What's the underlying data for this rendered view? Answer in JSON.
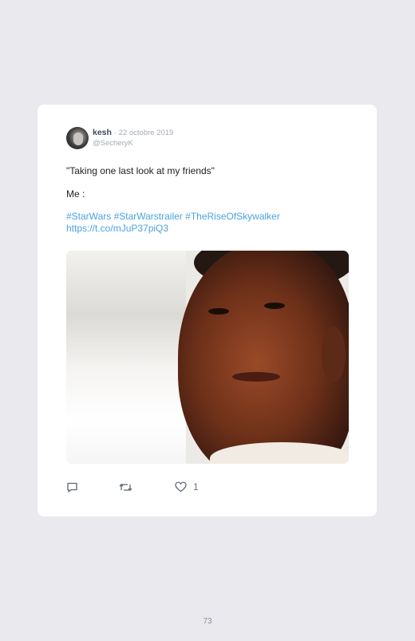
{
  "tweet": {
    "author_name": "kesh",
    "separator": "·",
    "date": "22 octobre 2019",
    "handle": "@SecheryK",
    "lines": [
      "\"Taking one last look at my friends\"",
      "Me :"
    ],
    "hashtags": "#StarWars #StarWarstrailer #TheRiseOfSkywalker",
    "url": "https://t.co/mJuP37piQ3",
    "like_count": "1"
  },
  "icons": {
    "reply": "reply-icon",
    "retweet": "retweet-icon",
    "like": "heart-icon"
  },
  "page": {
    "number": "73"
  }
}
